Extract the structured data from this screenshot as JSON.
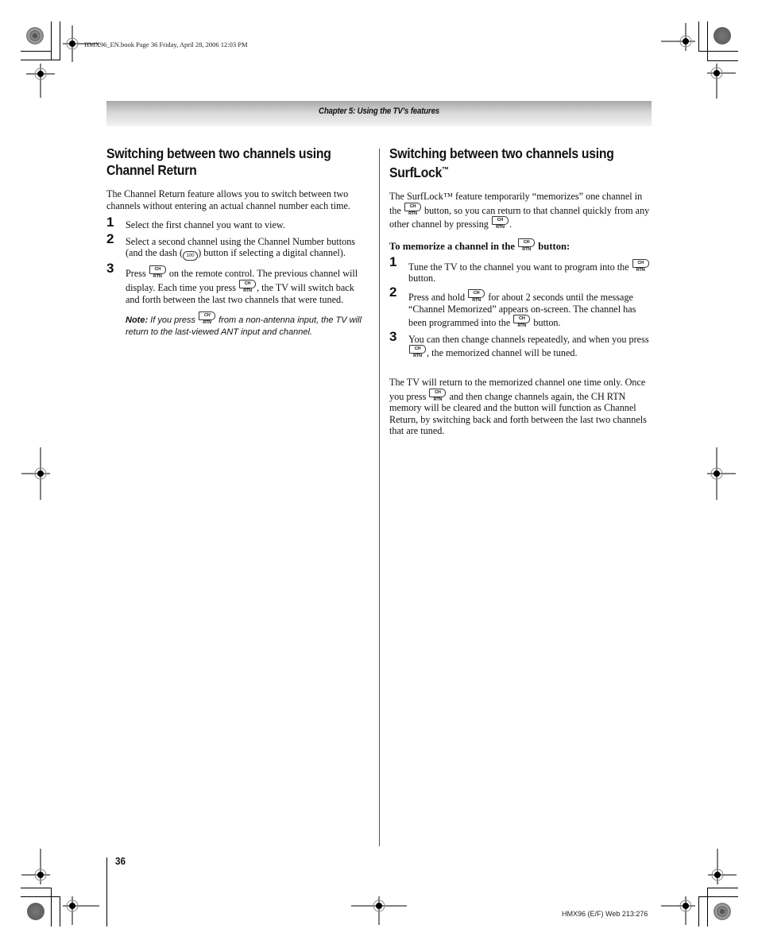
{
  "header": {
    "meta": "HMX96_EN.book  Page 36  Friday, April 28, 2006  12:03 PM",
    "chapter": "Chapter 5: Using the TV’s features"
  },
  "icons": {
    "ch_rtn": "CH RTN",
    "dash": "100"
  },
  "left": {
    "title_line1": "Switching between two channels using",
    "title_line2": "Channel Return",
    "intro": "The Channel Return feature allows you to switch between two channels without entering an actual channel number each time.",
    "steps": [
      {
        "num": "1",
        "text": "Select the first channel you want to view."
      },
      {
        "num": "2",
        "text_a": "Select a second channel using the Channel Number buttons (and the dash (",
        "text_b": ") button if selecting a digital channel)."
      },
      {
        "num": "3",
        "text_a": "Press ",
        "text_b": " on the remote control. The previous channel will display. Each time you press ",
        "text_c": ", the TV will switch back and forth between the last two channels that were tuned."
      }
    ],
    "note_label": "Note:",
    "note_a": " If you press ",
    "note_b": " from a non-antenna input, the TV will return to the last-viewed ANT input and channel."
  },
  "right": {
    "title_line1": "Switching between two channels using",
    "title_line2": "SurfLock",
    "title_tm": "™",
    "intro_a": "The SurfLock™ feature temporarily “memorizes” one channel in the ",
    "intro_b": " button, so you can return to that channel quickly from any other channel by pressing ",
    "intro_c": ".",
    "subhead_a": "To memorize a channel in the ",
    "subhead_b": " button:",
    "steps": [
      {
        "num": "1",
        "text_a": "Tune the TV to the channel you want to program into the ",
        "text_b": " button."
      },
      {
        "num": "2",
        "text_a": "Press and hold ",
        "text_b": " for about 2 seconds until the message “Channel Memorized” appears on-screen. The channel has been programmed into the ",
        "text_c": " button."
      },
      {
        "num": "3",
        "text_a": "You can then change channels repeatedly, and when you press ",
        "text_b": ", the memorized channel will be tuned."
      }
    ],
    "closing_a": "The TV will return to the memorized channel one time only. Once you press ",
    "closing_b": " and then change channels again, the CH RTN memory will be cleared and the button will function as Channel Return, by switching back and forth between the last two channels that are tuned."
  },
  "footer": {
    "page_number": "36",
    "code": "HMX96 (E/F) Web 213:276"
  }
}
